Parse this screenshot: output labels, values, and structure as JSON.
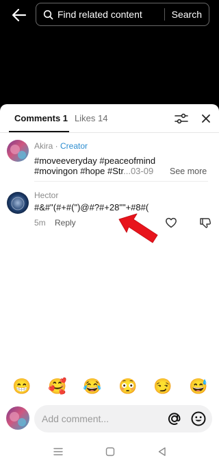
{
  "topbar": {
    "search_placeholder": "Find related content",
    "search_button": "Search"
  },
  "tabs": {
    "comments": "Comments 1",
    "likes": "Likes 14"
  },
  "comments": [
    {
      "author": "Akira",
      "separator": " · ",
      "badge": "Creator",
      "line1": "#moveeveryday #peaceofmind",
      "line2": "#movingon #hope #Str",
      "date": "...03-09",
      "see_more": "See more"
    },
    {
      "author": "Hector",
      "text": "#&#\"(#+#(\")@#?#+28\"\"+#8#(",
      "time": "5m",
      "reply": "Reply"
    }
  ],
  "emojis": [
    "😁",
    "🥰",
    "😂",
    "😳",
    "😏",
    "😅"
  ],
  "input": {
    "placeholder": "Add comment..."
  },
  "colors": {
    "creator": "#2a8cd0",
    "annotation_arrow": "#e8141c"
  }
}
